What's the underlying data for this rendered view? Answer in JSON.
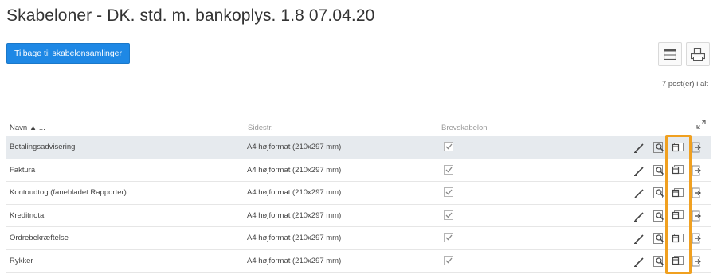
{
  "page": {
    "title": "Skabeloner - DK. std. m. bankoplys. 1.8 07.04.20"
  },
  "toolbar": {
    "back_label": "Tilbage til skabelonsamlinger",
    "table_view_icon": "table-icon",
    "print_icon": "printer-icon"
  },
  "summary": {
    "post_count": "7 post(er) i alt"
  },
  "table": {
    "headers": {
      "name": "Navn ▲ ...",
      "size": "Sidestr.",
      "letter_template": "Brevskabelon"
    },
    "rows": [
      {
        "name": "Betalingsadvisering",
        "size": "A4 højformat (210x297 mm)",
        "letter_template": true,
        "selected": true
      },
      {
        "name": "Faktura",
        "size": "A4 højformat (210x297 mm)",
        "letter_template": true,
        "selected": false
      },
      {
        "name": "Kontoudtog (fanebladet Rapporter)",
        "size": "A4 højformat (210x297 mm)",
        "letter_template": true,
        "selected": false
      },
      {
        "name": "Kreditnota",
        "size": "A4 højformat (210x297 mm)",
        "letter_template": true,
        "selected": false
      },
      {
        "name": "Ordrebekræftelse",
        "size": "A4 højformat (210x297 mm)",
        "letter_template": true,
        "selected": false
      },
      {
        "name": "Rykker",
        "size": "A4 højformat (210x297 mm)",
        "letter_template": true,
        "selected": false
      }
    ],
    "row_action_icons": [
      "pencil-icon",
      "preview-icon",
      "copy-icon",
      "export-icon"
    ]
  },
  "colors": {
    "primary": "#1e88e5",
    "selected_row": "#e6eaee",
    "highlight": "#f0a020"
  }
}
